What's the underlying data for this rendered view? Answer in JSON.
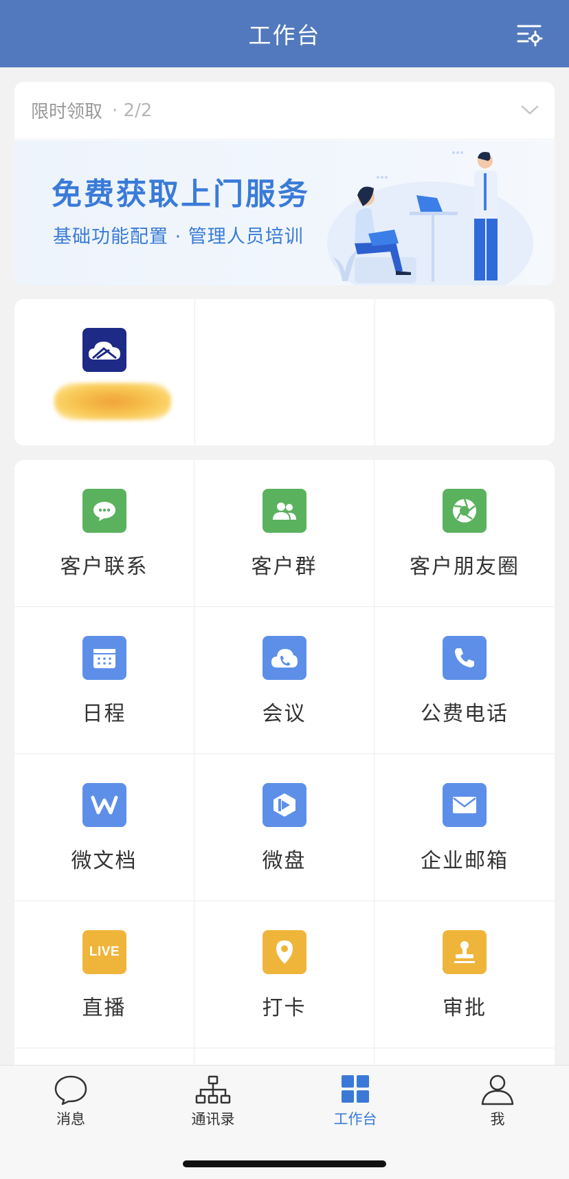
{
  "header": {
    "title": "工作台",
    "settings_icon": "list-settings-icon"
  },
  "promo": {
    "label": "限时领取",
    "count": "· 2/2",
    "headline": "免费获取上门服务",
    "subline": "基础功能配置 · 管理人员培训"
  },
  "apps": {
    "icon": "cloud-app-icon",
    "icon_color": "#1d2a86"
  },
  "grid": [
    {
      "label": "客户联系",
      "icon": "chat-bubble-icon",
      "color": "#5ab25e"
    },
    {
      "label": "客户群",
      "icon": "group-icon",
      "color": "#5ab25e"
    },
    {
      "label": "客户朋友圈",
      "icon": "aperture-icon",
      "color": "#5ab25e"
    },
    {
      "label": "日程",
      "icon": "calendar-icon",
      "color": "#5d8fe8"
    },
    {
      "label": "会议",
      "icon": "cloud-phone-icon",
      "color": "#5d8fe8"
    },
    {
      "label": "公费电话",
      "icon": "phone-icon",
      "color": "#5d8fe8"
    },
    {
      "label": "微文档",
      "icon": "doc-w-icon",
      "color": "#5d8fe8"
    },
    {
      "label": "微盘",
      "icon": "drive-icon",
      "color": "#5d8fe8"
    },
    {
      "label": "企业邮箱",
      "icon": "mail-icon",
      "color": "#5d8fe8"
    },
    {
      "label": "直播",
      "icon": "live-icon",
      "icon_text": "LIVE",
      "color": "#efb53b"
    },
    {
      "label": "打卡",
      "icon": "location-pin-icon",
      "color": "#efb53b"
    },
    {
      "label": "审批",
      "icon": "stamp-icon",
      "color": "#efb53b"
    }
  ],
  "tabs": [
    {
      "label": "消息",
      "icon": "message-icon"
    },
    {
      "label": "通讯录",
      "icon": "org-chart-icon"
    },
    {
      "label": "工作台",
      "icon": "grid-icon",
      "active": true
    },
    {
      "label": "我",
      "icon": "person-icon"
    }
  ],
  "colors": {
    "header": "#5279bd",
    "accent": "#3b79d8"
  }
}
